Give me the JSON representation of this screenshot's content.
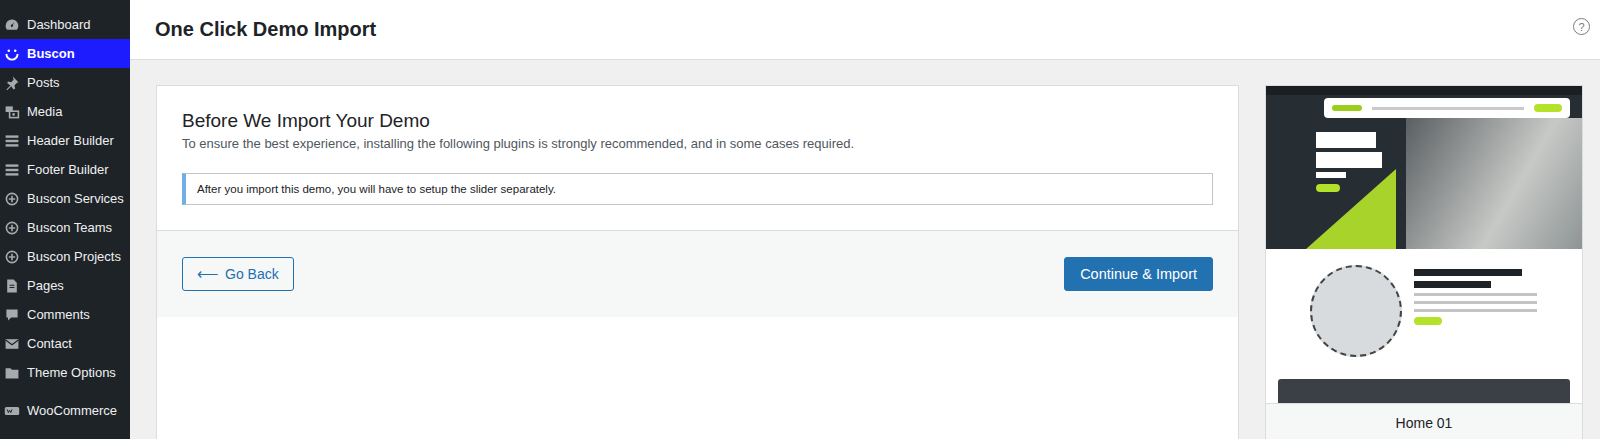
{
  "sidebar": {
    "items": [
      {
        "label": "Dashboard",
        "kind": "gauge",
        "selected": false
      },
      {
        "label": "Buscon",
        "kind": "smile",
        "selected": true
      },
      {
        "label": "Posts",
        "kind": "pin",
        "selected": false
      },
      {
        "label": "Media",
        "kind": "media",
        "selected": false
      },
      {
        "label": "Header Builder",
        "kind": "rows",
        "selected": false
      },
      {
        "label": "Footer Builder",
        "kind": "rows",
        "selected": false
      },
      {
        "label": "Buscon Services",
        "kind": "plus",
        "selected": false
      },
      {
        "label": "Buscon Teams",
        "kind": "plus",
        "selected": false
      },
      {
        "label": "Buscon Projects",
        "kind": "plus",
        "selected": false
      },
      {
        "label": "Pages",
        "kind": "page",
        "selected": false
      },
      {
        "label": "Comments",
        "kind": "comment",
        "selected": false
      },
      {
        "label": "Contact",
        "kind": "mail",
        "selected": false
      },
      {
        "label": "Theme Options",
        "kind": "folder",
        "selected": false
      },
      {
        "label": "WooCommerce",
        "kind": "woo",
        "selected": false
      }
    ]
  },
  "header": {
    "title": "One Click Demo Import",
    "help": "?"
  },
  "intro": {
    "title": "Before We Import Your Demo",
    "text": "To ensure the best experience, installing the following plugins is strongly recommended, and in some cases required."
  },
  "notice": "After you import this demo, you will have to setup the slider separately.",
  "back_button": {
    "icon": "⟵",
    "label": "Go Back"
  },
  "import_button": {
    "label": "Continue & Import"
  },
  "demo": {
    "name": "Home 01"
  }
}
